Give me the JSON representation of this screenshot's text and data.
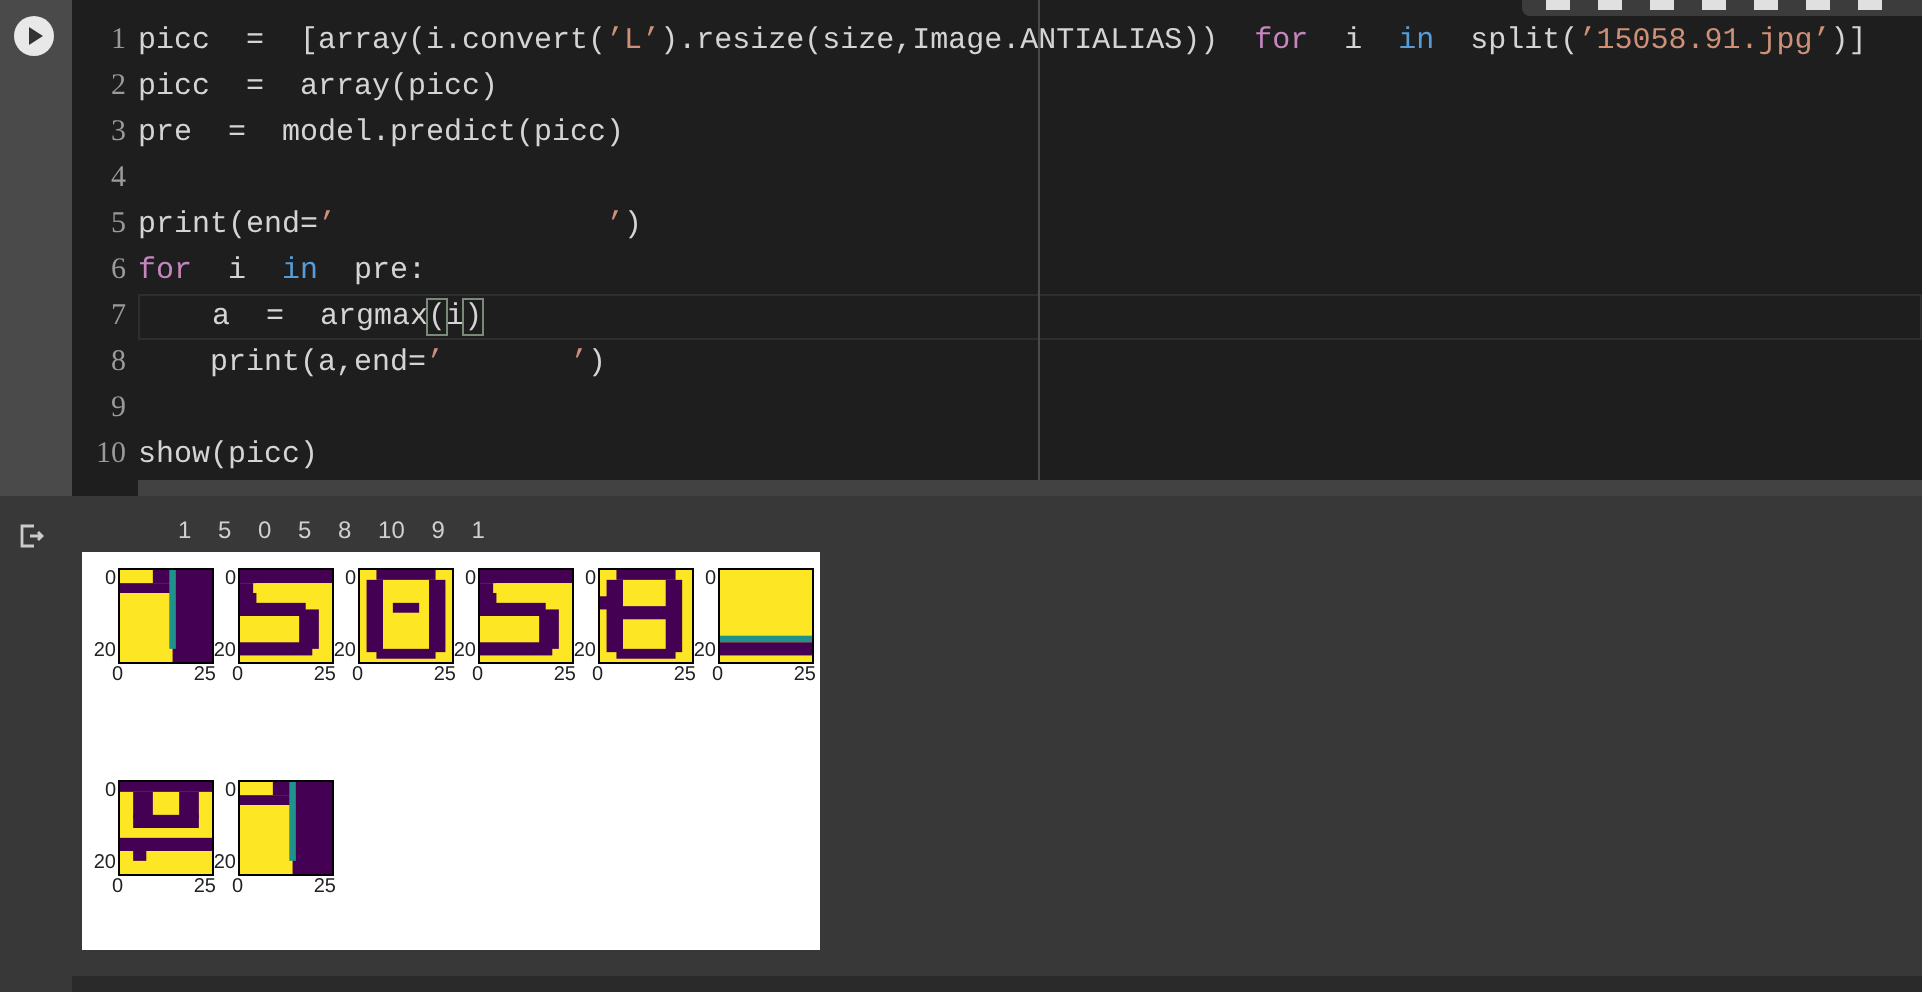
{
  "code_cell": {
    "lines": [
      {
        "number": "1",
        "current": false,
        "tokens": [
          {
            "kind": "plain",
            "text": "picc  =  [array(i.convert("
          },
          {
            "kind": "string",
            "text": "’L’"
          },
          {
            "kind": "plain",
            "text": ").resize(size,Image.ANTIALIAS))  "
          },
          {
            "kind": "keyword",
            "text": "for"
          },
          {
            "kind": "plain",
            "text": "  i  "
          },
          {
            "kind": "operator",
            "text": "in"
          },
          {
            "kind": "plain",
            "text": "  split("
          },
          {
            "kind": "string",
            "text": "’15058.91.jpg’"
          },
          {
            "kind": "plain",
            "text": ")]"
          }
        ]
      },
      {
        "number": "2",
        "current": false,
        "tokens": [
          {
            "kind": "plain",
            "text": "picc  =  array(picc)"
          }
        ]
      },
      {
        "number": "3",
        "current": false,
        "tokens": [
          {
            "kind": "plain",
            "text": "pre  =  model.predict(picc)"
          }
        ]
      },
      {
        "number": "4",
        "current": false
      },
      {
        "number": "5",
        "current": false,
        "tokens": [
          {
            "kind": "plain",
            "text": "print(end="
          },
          {
            "kind": "string",
            "text": "’               ’"
          },
          {
            "kind": "plain",
            "text": ")"
          }
        ]
      },
      {
        "number": "6",
        "current": false,
        "tokens": [
          {
            "kind": "keyword",
            "text": "for"
          },
          {
            "kind": "plain",
            "text": "  i  "
          },
          {
            "kind": "operator",
            "text": "in"
          },
          {
            "kind": "plain",
            "text": "  pre:"
          }
        ]
      },
      {
        "number": "7",
        "current": true,
        "tokens": [
          {
            "kind": "plain",
            "text": "    a  =  argmax"
          },
          {
            "kind": "bracket",
            "text": "("
          },
          {
            "kind": "plain",
            "text": "i"
          },
          {
            "kind": "bracket",
            "text": ")"
          }
        ]
      },
      {
        "number": "8",
        "current": false,
        "tokens": [
          {
            "kind": "plain",
            "text": "    print(a,end="
          },
          {
            "kind": "string",
            "text": "’       ’"
          },
          {
            "kind": "plain",
            "text": ")"
          }
        ]
      },
      {
        "number": "9",
        "current": false
      },
      {
        "number": "10",
        "current": false,
        "tokens": [
          {
            "kind": "plain",
            "text": "show(picc)"
          }
        ]
      }
    ]
  },
  "output": {
    "text": "1    5    0    5    8    10    9    1",
    "figure": {
      "rows": [
        [
          {
            "kind": "picture",
            "yticks": [
              "0",
              "20"
            ],
            "xticks": [
              "0",
              "25"
            ]
          },
          {
            "kind": "picture",
            "yticks": [
              "0",
              "20"
            ],
            "xticks": [
              "0",
              "25"
            ]
          },
          {
            "kind": "picture",
            "yticks": [
              "0",
              "20"
            ],
            "xticks": [
              "0",
              "25"
            ]
          },
          {
            "kind": "picture",
            "yticks": [
              "0",
              "20"
            ],
            "xticks": [
              "0",
              "25"
            ]
          },
          {
            "kind": "picture",
            "yticks": [
              "0",
              "20"
            ],
            "xticks": [
              "0",
              "25"
            ]
          },
          {
            "kind": "picture",
            "yticks": [
              "0",
              "20"
            ],
            "xticks": [
              "0",
              "25"
            ]
          }
        ],
        [
          {
            "kind": "picture",
            "yticks": [
              "0",
              "20"
            ],
            "xticks": [
              "0",
              "25"
            ]
          },
          {
            "kind": "picture",
            "yticks": [
              "0",
              "20"
            ],
            "xticks": [
              "0",
              "25"
            ]
          }
        ]
      ]
    }
  }
}
